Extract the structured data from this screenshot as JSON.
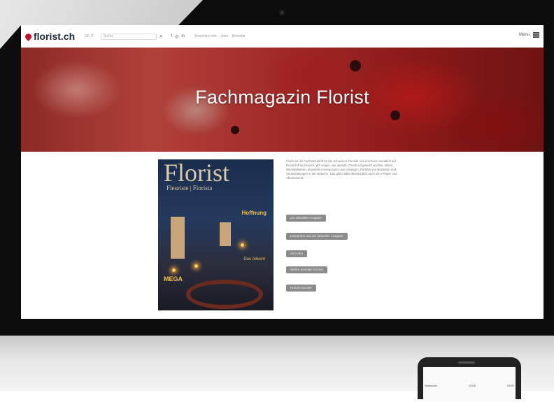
{
  "brand": {
    "name": "florist.ch",
    "accent": "#c8102e"
  },
  "nav": {
    "lang": "DE IT",
    "search_placeholder": "Suche",
    "social": [
      "f",
      "◎",
      "in"
    ],
    "links": [
      "Branchen-Info",
      "Jobs",
      "Betriebe"
    ],
    "menu_label": "Menu"
  },
  "hero": {
    "title": "Fachmagazin Florist"
  },
  "magazine": {
    "title": "Florist",
    "subtitle": "Fleuriste | Fiorista",
    "headline_1": "Hoffnung",
    "headline_2": "Das Advent",
    "headline_3": "MEGA"
  },
  "description": "Florist ist die Fachzeitschrift für die Schweizer Floristik und erscheint monatlich auf Deutsch/Französisch. Wir zeigen, wie aktuelle Trends umgesetzt werden, liefern Werkstattideen, inspirieren Anregungen und Lösungen, Porträts von Betrieben und Veranstaltungen in der Branche. Das gibt's alles übersichtlich auch als e-Paper und Abonnement.",
  "buttons": [
    "Zur aktuellen Ausgabe",
    "Leseprobe aus der aktuellen Ausgabe",
    "Zum Abo",
    "Werbe-Inserate buchen",
    "Rubrik Inserate"
  ],
  "phone": {
    "carrier": "Swisscom",
    "time": "13:06",
    "battery": "100%"
  }
}
